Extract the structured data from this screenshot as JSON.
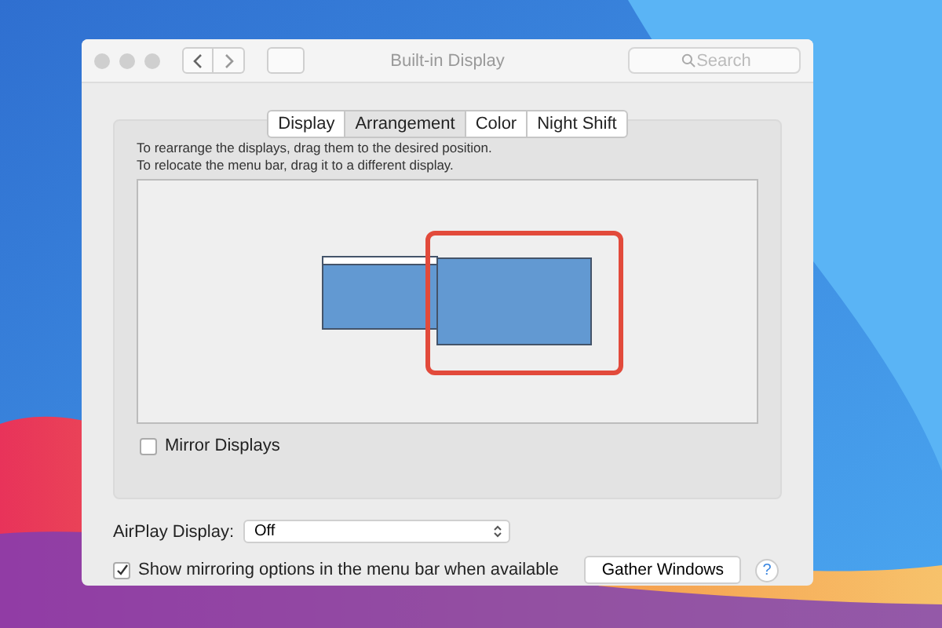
{
  "window": {
    "title": "Built-in Display"
  },
  "search": {
    "placeholder": "Search"
  },
  "tabs": [
    {
      "label": "Display",
      "selected": false
    },
    {
      "label": "Arrangement",
      "selected": true
    },
    {
      "label": "Color",
      "selected": false
    },
    {
      "label": "Night Shift",
      "selected": false
    }
  ],
  "instructions": [
    "To rearrange the displays, drag them to the desired position.",
    "To relocate the menu bar, drag it to a different display."
  ],
  "mirror_displays": {
    "label": "Mirror Displays",
    "checked": false
  },
  "airplay": {
    "label": "AirPlay Display:",
    "value": "Off"
  },
  "show_mirroring": {
    "label": "Show mirroring options in the menu bar when available",
    "checked": true
  },
  "gather_button": "Gather Windows",
  "help_button": "?"
}
